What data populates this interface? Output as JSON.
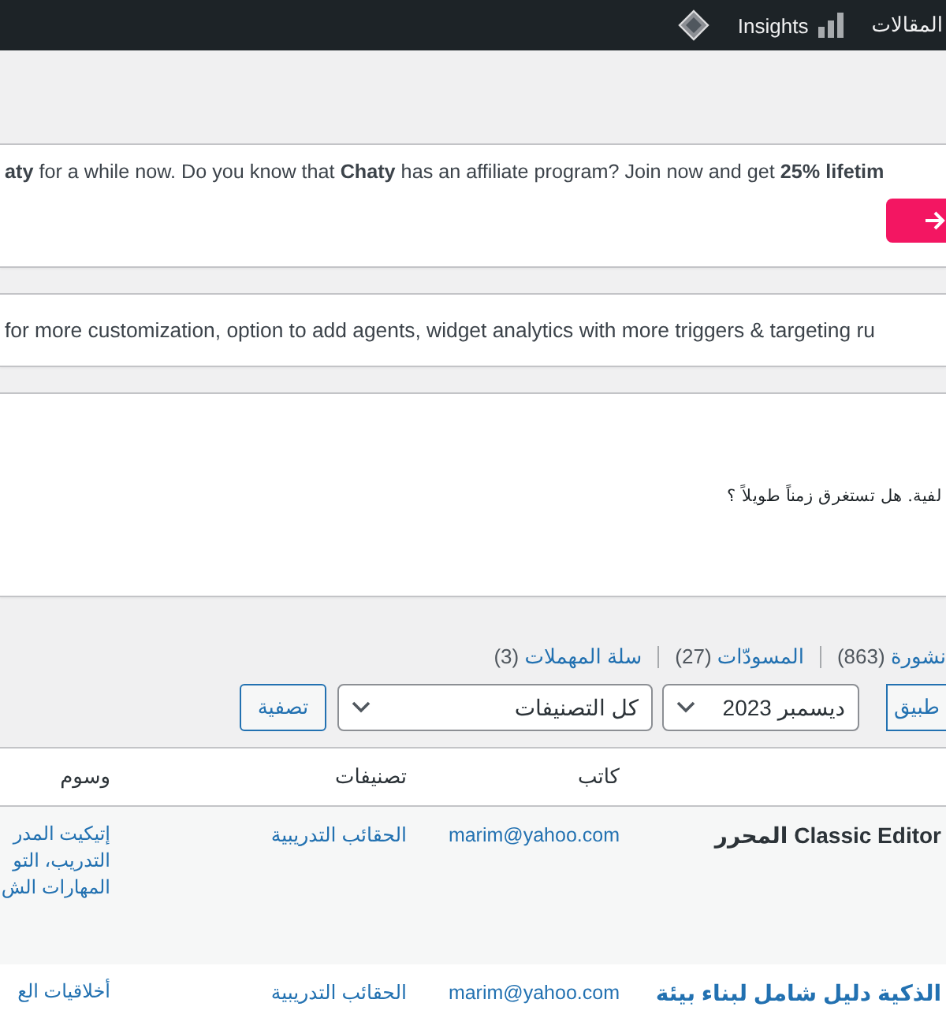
{
  "admin_bar": {
    "items": [
      {
        "kind": "menu",
        "label": "المقالات"
      },
      {
        "kind": "insights",
        "label": "Insights"
      },
      {
        "kind": "logo"
      }
    ]
  },
  "notices": [
    {
      "kind": "affiliate",
      "text": "**aty** for a while now. Do you know that **Chaty** has an affiliate program? Join now and get **25% lifetim**"
    },
    {
      "kind": "upgrade",
      "text": "for more customization, option to add agents, widget analytics with more triggers & targeting ru"
    },
    {
      "kind": "message",
      "text": "لفية. هل تستغرق زمناً طويلاً ؟"
    }
  ],
  "status_links": [
    {
      "label": "نشورة",
      "count": "(863)"
    },
    {
      "label": "المسودّات",
      "count": "(27)"
    },
    {
      "label": "سلة المهملات",
      "count": "(3)"
    }
  ],
  "filters": {
    "apply_button": "طبيق",
    "date": "ديسمبر 2023",
    "category": "كل التصنيفات",
    "filter_button": "تصفية"
  },
  "table": {
    "columns": [
      "كاتب",
      "تصنيفات",
      "وسوم"
    ],
    "rows": [
      {
        "kind": "plain",
        "title": "Classic Editor المحرر",
        "author": "marim@yahoo.com",
        "category": "الحقائب التدريبية",
        "tags": [
          "إتيكيت المدر",
          "التدريب، التو",
          "المهارات الش"
        ]
      },
      {
        "kind": "link",
        "title": "الذكية دليل شامل لبناء بيئة",
        "author": "marim@yahoo.com",
        "category": "الحقائب التدريبية",
        "tags": [
          "أخلاقيات الع"
        ]
      }
    ]
  }
}
